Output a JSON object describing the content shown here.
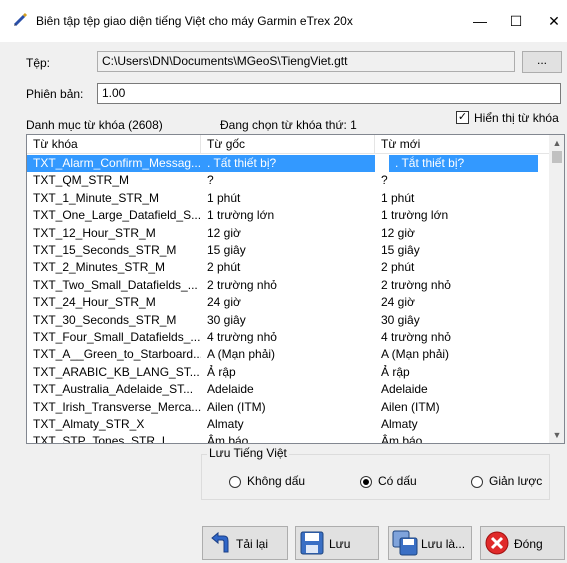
{
  "window": {
    "title": "Biên tập tệp giao diện tiếng Việt cho máy Garmin eTrex 20x",
    "minimize": "—",
    "maximize": "☐",
    "close": "✕"
  },
  "file": {
    "label": "Tệp:",
    "path": "C:\\Users\\DN\\Documents\\MGeoS\\TiengViet.gtt",
    "browse_label": "..."
  },
  "version": {
    "label": "Phiên bản:",
    "value": "1.00"
  },
  "status": {
    "catalog": "Danh mục từ khóa (2608)",
    "selected": "Đang chọn từ khóa thứ: 1",
    "show_keys_label": "Hiển thị từ khóa",
    "show_keys_checked": "✓"
  },
  "table": {
    "headers": [
      "Từ khóa",
      "Từ gốc",
      "Từ mới"
    ],
    "rows": [
      [
        "TXT_Alarm_Confirm_Messag...",
        ". Tất thiết bị?",
        ". Tắt thiết bị?"
      ],
      [
        "TXT_QM_STR_M",
        "?",
        "?"
      ],
      [
        "TXT_1_Minute_STR_M",
        "1 phút",
        "1 phút"
      ],
      [
        "TXT_One_Large_Datafield_S...",
        "1 trường lớn",
        "1 trường lớn"
      ],
      [
        "TXT_12_Hour_STR_M",
        "12 giờ",
        "12 giờ"
      ],
      [
        "TXT_15_Seconds_STR_M",
        "15 giây",
        "15 giây"
      ],
      [
        "TXT_2_Minutes_STR_M",
        "2 phút",
        "2 phút"
      ],
      [
        "TXT_Two_Small_Datafields_...",
        "2 trường nhỏ",
        "2 trường nhỏ"
      ],
      [
        "TXT_24_Hour_STR_M",
        "24 giờ",
        "24 giờ"
      ],
      [
        "TXT_30_Seconds_STR_M",
        "30 giây",
        "30 giây"
      ],
      [
        "TXT_Four_Small_Datafields_...",
        "4 trường nhỏ",
        "4 trường nhỏ"
      ],
      [
        "TXT_A__Green_to_Starboard...",
        "A (Mạn phải)",
        "A (Mạn phải)"
      ],
      [
        "TXT_ARABIC_KB_LANG_ST...",
        "Ả rập",
        "Ả rập"
      ],
      [
        "TXT_Australia_Adelaide_ST...",
        "Adelaide",
        "Adelaide"
      ],
      [
        "TXT_Irish_Transverse_Merca...",
        "Ailen (ITM)",
        "Ailen (ITM)"
      ],
      [
        "TXT_Almaty_STR_X",
        "Almaty",
        "Almaty"
      ],
      [
        "TXT_STP_Tones_STR_I",
        "Âm báo",
        "Âm báo"
      ]
    ]
  },
  "save_group": {
    "legend": "Lưu Tiếng Việt",
    "options": [
      "Không dấu",
      "Có dấu",
      "Giản lược"
    ],
    "selected_index": 1
  },
  "buttons": {
    "reload": "Tải lại",
    "save": "Lưu",
    "save_as": "Lưu là...",
    "close": "Đóng"
  }
}
